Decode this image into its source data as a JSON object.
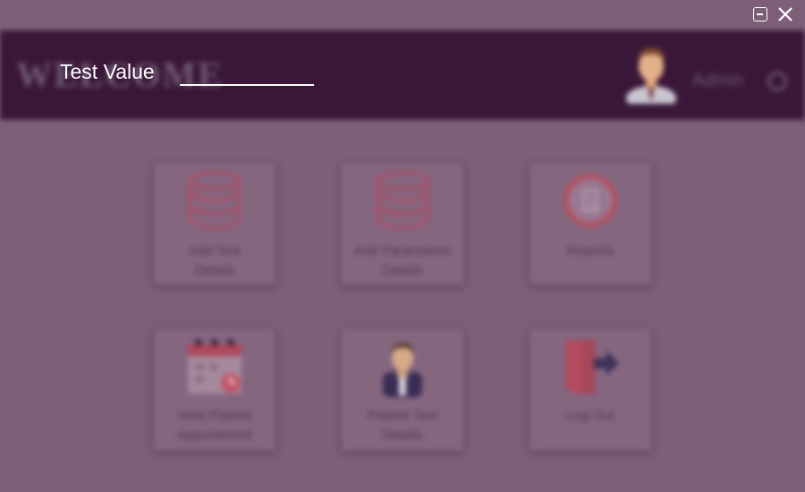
{
  "header": {
    "welcome": "WELCOME",
    "admin_name": "Admin"
  },
  "tiles": [
    {
      "label": "Add Test\nDetails",
      "icon": "database-icon"
    },
    {
      "label": "Add Parameters\nDetails",
      "icon": "database-icon"
    },
    {
      "label": "Reports",
      "icon": "report-icon"
    },
    {
      "label": "View Patient\nAppointment",
      "icon": "calendar-icon"
    },
    {
      "label": "Patient Test\nDetails",
      "icon": "patient-icon"
    },
    {
      "label": "Log Out",
      "icon": "logout-icon"
    }
  ],
  "overlay": {
    "value_label": "Test Value"
  },
  "colors": {
    "header_bg": "#3a1739",
    "overlay_bg": "#7d5f78",
    "text_light": "#ffffff"
  }
}
